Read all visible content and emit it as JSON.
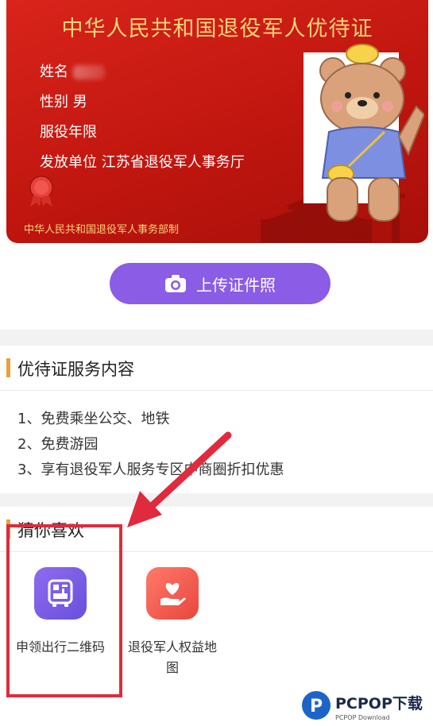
{
  "card": {
    "title": "中华人民共和国退役军人优待证",
    "name_label": "姓名",
    "gender_row": "性别 男",
    "service_label": "服役年限",
    "issuer_row": "发放单位  江苏省退役军人事务厅",
    "issuer_footer": "中华人民共和国退役军人事务部制",
    "colors": {
      "card_red": "#c0160f",
      "gold": "#f6d57a"
    }
  },
  "upload": {
    "label": "上传证件照",
    "icon": "camera-icon",
    "color": "#8b5ce6"
  },
  "services": {
    "title": "优待证服务内容",
    "items": [
      "1、免费乘坐公交、地铁",
      "2、免费游园",
      "3、享有退役军人服务专区中商圈折扣优惠"
    ]
  },
  "recommend": {
    "title": "猜你喜欢",
    "apps": [
      {
        "label": "申领出行二维码",
        "icon": "qr-code-icon",
        "color": "#7b5ce8"
      },
      {
        "label": "退役军人权益地图",
        "icon": "heart-hand-icon",
        "color": "#f0584f"
      }
    ]
  },
  "watermark": {
    "brand": "PCPOP下载",
    "sub": "PCPOP Download"
  }
}
